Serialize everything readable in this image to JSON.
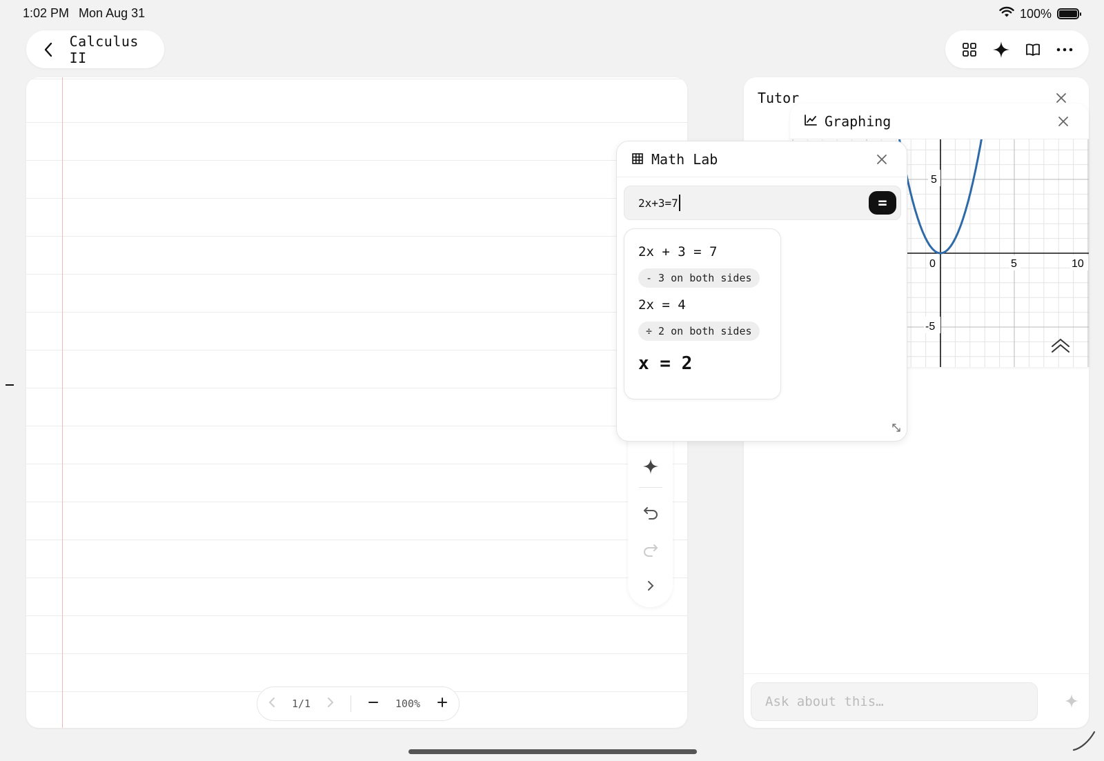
{
  "status_bar": {
    "time": "1:02 PM",
    "date": "Mon Aug 31",
    "battery": "100%",
    "battery_level": 1.0
  },
  "header": {
    "notebook_title": "Calculus II"
  },
  "page_nav": {
    "page": "1/1",
    "zoom": "100%"
  },
  "tutor": {
    "title": "Tutor",
    "ask_placeholder": "Ask about this…"
  },
  "graphing": {
    "title": "Graphing",
    "y_ticks": [
      "5",
      "-5"
    ],
    "x_ticks": [
      "0",
      "5",
      "10"
    ],
    "curve_color": "#2f6aa8"
  },
  "math_lab": {
    "title": "Math Lab",
    "input_value": "2x+3=7",
    "solve_label": "=",
    "steps": {
      "line1": "2x + 3 = 7",
      "op1": "- 3 on both sides",
      "line2": "2x = 4",
      "op2": "÷ 2 on both sides",
      "result": "x = 2"
    }
  }
}
